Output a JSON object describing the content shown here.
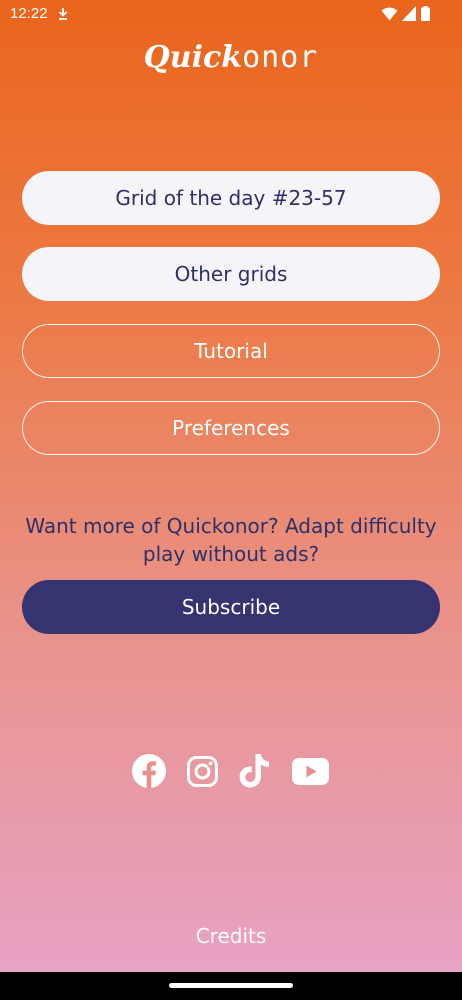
{
  "status_bar": {
    "time": "12:22",
    "icons": [
      "download-icon",
      "wifi-icon",
      "signal-icon",
      "battery-icon"
    ]
  },
  "app": {
    "logo_bold": "Quick",
    "logo_light": "onor"
  },
  "menu": {
    "grid_of_day_label": "Grid of the day #23-57",
    "other_grids_label": "Other grids",
    "tutorial_label": "Tutorial",
    "preferences_label": "Preferences"
  },
  "promo": {
    "line1": "Want more of Quickonor? Adapt difficulty",
    "line2": "play without ads?",
    "subscribe_label": "Subscribe"
  },
  "social": {
    "icons": [
      "facebook-icon",
      "instagram-icon",
      "tiktok-icon",
      "youtube-icon"
    ]
  },
  "footer": {
    "credits_label": "Credits"
  },
  "colors": {
    "gradient_top": "#EA651C",
    "gradient_bottom": "#E8A3C8",
    "primary_navy": "#353470",
    "button_text_navy": "#2E3168",
    "button_fill": "#F5F4F8"
  }
}
